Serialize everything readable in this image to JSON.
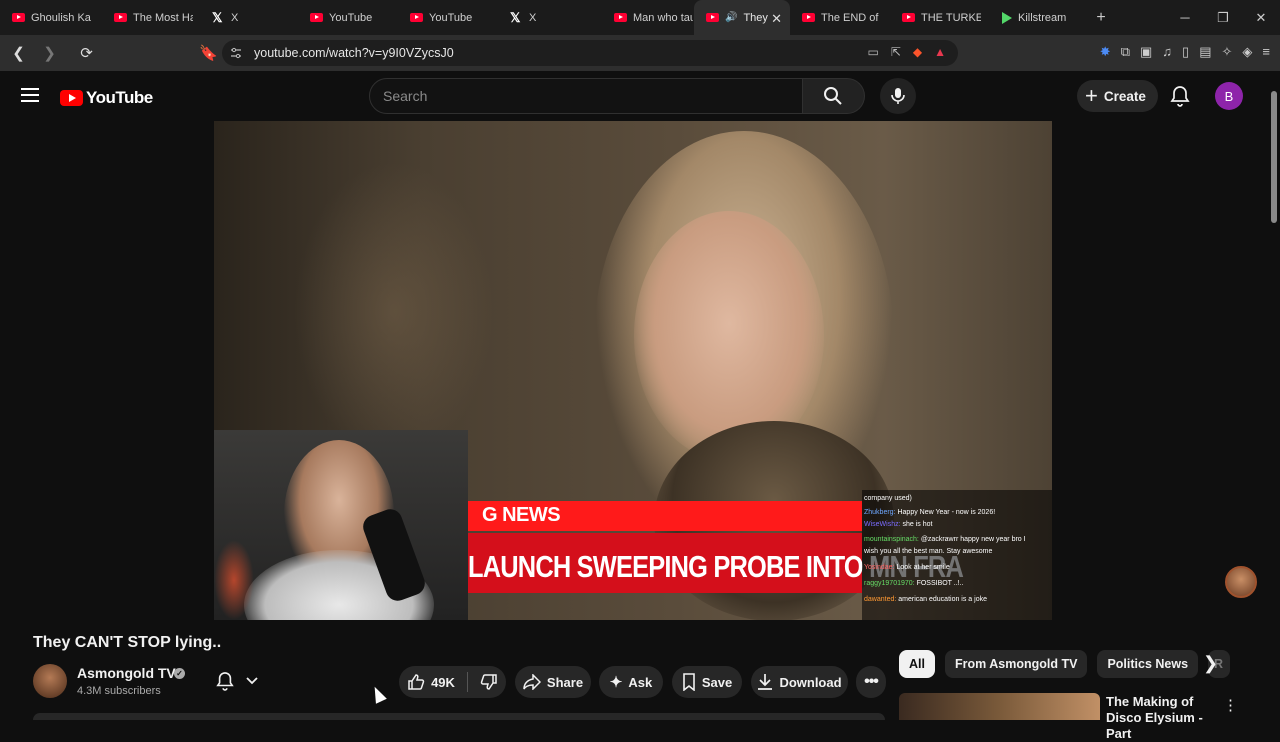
{
  "browser": {
    "tabs": [
      {
        "label": "Ghoulish Kar",
        "icon": "youtube-icon"
      },
      {
        "label": "The Most Ha",
        "icon": "youtube-icon"
      },
      {
        "label": "X",
        "icon": "x-icon"
      },
      {
        "label": "YouTube",
        "icon": "youtube-icon"
      },
      {
        "label": "YouTube",
        "icon": "youtube-icon"
      },
      {
        "label": "X",
        "icon": "x-icon"
      },
      {
        "label": "Man who tau",
        "icon": "youtube-icon"
      },
      {
        "label": "They C",
        "icon": "youtube-icon",
        "active": true
      },
      {
        "label": "The END of L",
        "icon": "youtube-icon"
      },
      {
        "label": "THE TURKEY",
        "icon": "youtube-icon"
      },
      {
        "label": "Killstream",
        "icon": "kick-icon"
      }
    ],
    "url": "youtube.com/watch?v=y9I0VZycsJ0"
  },
  "youtube": {
    "logo_text": "YouTube",
    "search_placeholder": "Search",
    "create_label": "Create",
    "avatar_letter": "B"
  },
  "video": {
    "news_label": "G NEWS",
    "headline": "LAUNCH SWEEPING PROBE INTO MN FRA",
    "chat": [
      {
        "user": "",
        "text": "company used)"
      },
      {
        "user": "Zhukberg:",
        "text": "Happy New Year - now is 2026!"
      },
      {
        "user": "WiseWishz:",
        "text": "she is hot"
      },
      {
        "user": "mountainspinach:",
        "text": "@zackrawrr happy new year bro I"
      },
      {
        "user": "",
        "text": "wish you all the best man. Stay awesome"
      },
      {
        "user": "Yosindae:",
        "text": "Look at her smile"
      },
      {
        "user": "raggy19701970:",
        "text": "FOSSIBOT ..!.."
      },
      {
        "user": "dawanted:",
        "text": "american education is a joke"
      }
    ]
  },
  "meta": {
    "title": "They CAN'T STOP lying..",
    "channel": "Asmongold TV",
    "subscribers": "4.3M subscribers",
    "likes": "49K",
    "share": "Share",
    "ask": "Ask",
    "save": "Save",
    "download": "Download"
  },
  "sidebar": {
    "chips": [
      "All",
      "From Asmongold TV",
      "Politics News",
      "R"
    ],
    "rec_title": "The Making of Disco Elysium - Part"
  },
  "colors": {
    "brand_red": "#ff0000",
    "avatar_purple": "#8e24aa",
    "background": "#0f0f0f"
  }
}
